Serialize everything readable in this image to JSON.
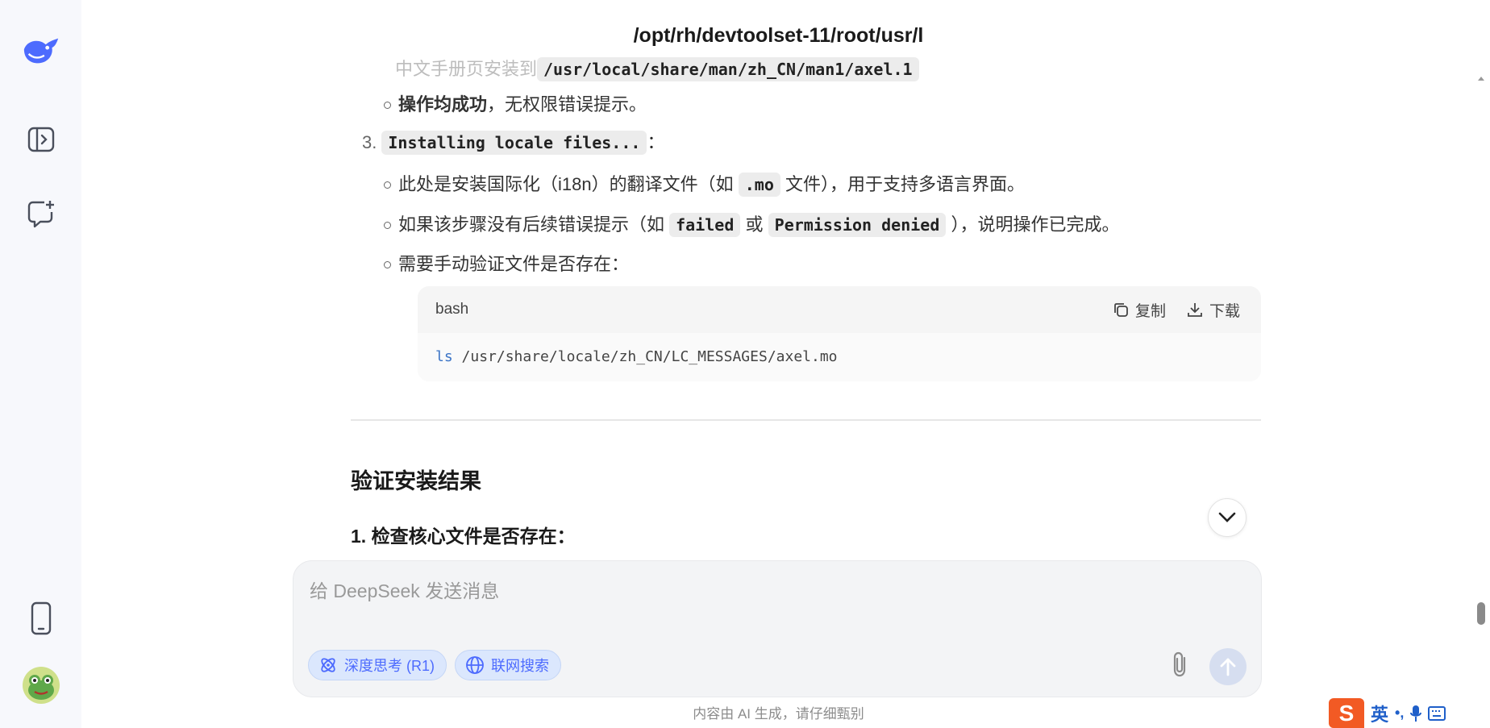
{
  "header": {
    "title": "/opt/rh/devtoolset-11/root/usr/l"
  },
  "content": {
    "faded_line": {
      "text": "中文手册页安装到",
      "code": "/usr/local/share/man/zh_CN/man1/axel.1"
    },
    "bullet_ok": {
      "bold": "操作均成功",
      "rest": "，无权限错误提示。"
    },
    "item3": {
      "number": "3.",
      "code": "Installing locale files...",
      "suffix": "："
    },
    "bullet_i18n": {
      "pre": "此处是安装国际化（i18n）的翻译文件（如",
      "code": ".mo",
      "post": "文件），用于支持多语言界面。"
    },
    "bullet_errors": {
      "pre": "如果该步骤没有后续错误提示（如",
      "code1": "failed",
      "mid": "或",
      "code2": "Permission denied",
      "post": "），说明操作已完成。"
    },
    "bullet_verify": {
      "text": "需要手动验证文件是否存在："
    },
    "codeblock": {
      "lang": "bash",
      "copy_label": "复制",
      "download_label": "下载",
      "cmd": "ls",
      "args": " /usr/share/locale/zh_CN/LC_MESSAGES/axel.mo"
    },
    "heading": "验证安装结果",
    "subheading": "1. 检查核心文件是否存在："
  },
  "composer": {
    "placeholder": "给 DeepSeek 发送消息",
    "deep_think_label": "深度思考 (R1)",
    "web_search_label": "联网搜索"
  },
  "disclaimer": "内容由 AI 生成，请仔细甄别",
  "ime": {
    "logo": "S",
    "lang": "英",
    "punct": "•,"
  },
  "colors": {
    "accent": "#4d6bfe",
    "sidebar_bg": "#f7f8fc",
    "code_keyword": "#3b74c6"
  },
  "icons": [
    "deepseek-logo-icon",
    "sidebar-toggle-icon",
    "new-chat-icon",
    "mobile-icon",
    "avatar",
    "chevron-down-icon",
    "paperclip-icon",
    "send-arrow-icon",
    "atom-icon",
    "globe-icon",
    "copy-icon",
    "download-icon"
  ]
}
